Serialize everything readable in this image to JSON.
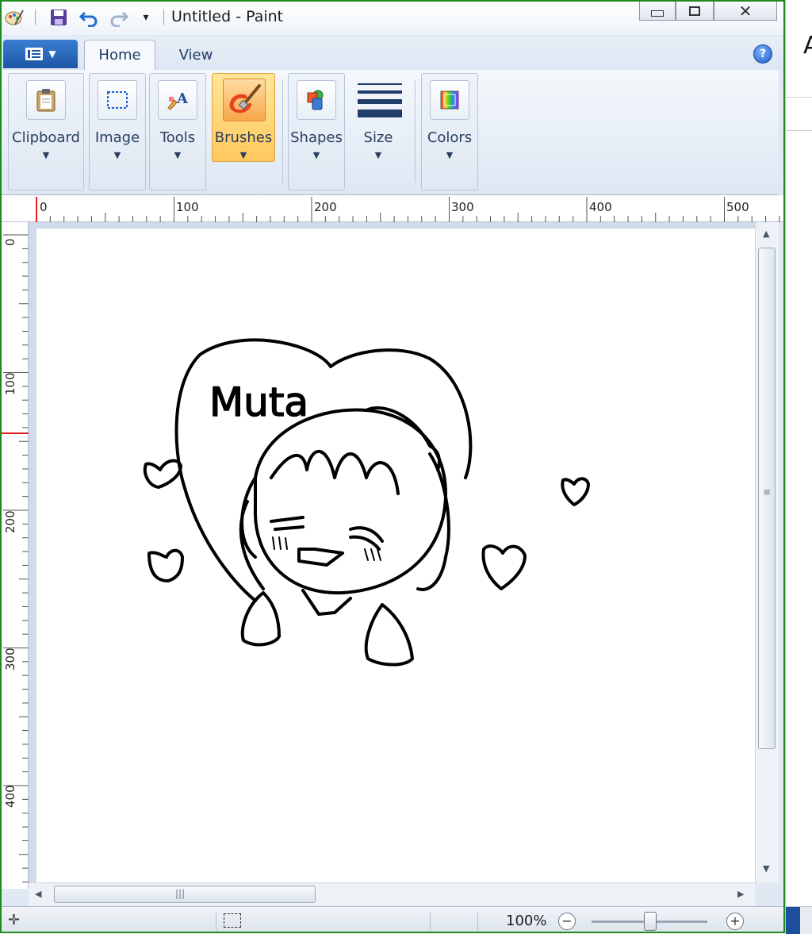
{
  "window": {
    "title": "Untitled - Paint"
  },
  "ribbon": {
    "tabs": [
      {
        "label": "Home",
        "active": true
      },
      {
        "label": "View",
        "active": false
      }
    ],
    "groups": [
      {
        "label": "Clipboard",
        "icon": "clipboard-icon"
      },
      {
        "label": "Image",
        "icon": "select-icon"
      },
      {
        "label": "Tools",
        "icon": "tools-icon"
      },
      {
        "label": "Brushes",
        "icon": "brush-icon",
        "active": true
      },
      {
        "label": "Shapes",
        "icon": "shapes-icon"
      },
      {
        "label": "Size",
        "icon": "size-icon"
      },
      {
        "label": "Colors",
        "icon": "colors-icon"
      }
    ]
  },
  "rulers": {
    "horizontal": [
      "0",
      "100",
      "200",
      "300",
      "400",
      "500"
    ],
    "vertical": [
      "0",
      "100",
      "200",
      "300",
      "400"
    ]
  },
  "canvas": {
    "handwritten_text": "Muta"
  },
  "status": {
    "zoom": "100%"
  },
  "colors": {
    "accent": "#1c56a6",
    "active_group": "#ffc85e",
    "window_border": "#1f8a1f"
  }
}
